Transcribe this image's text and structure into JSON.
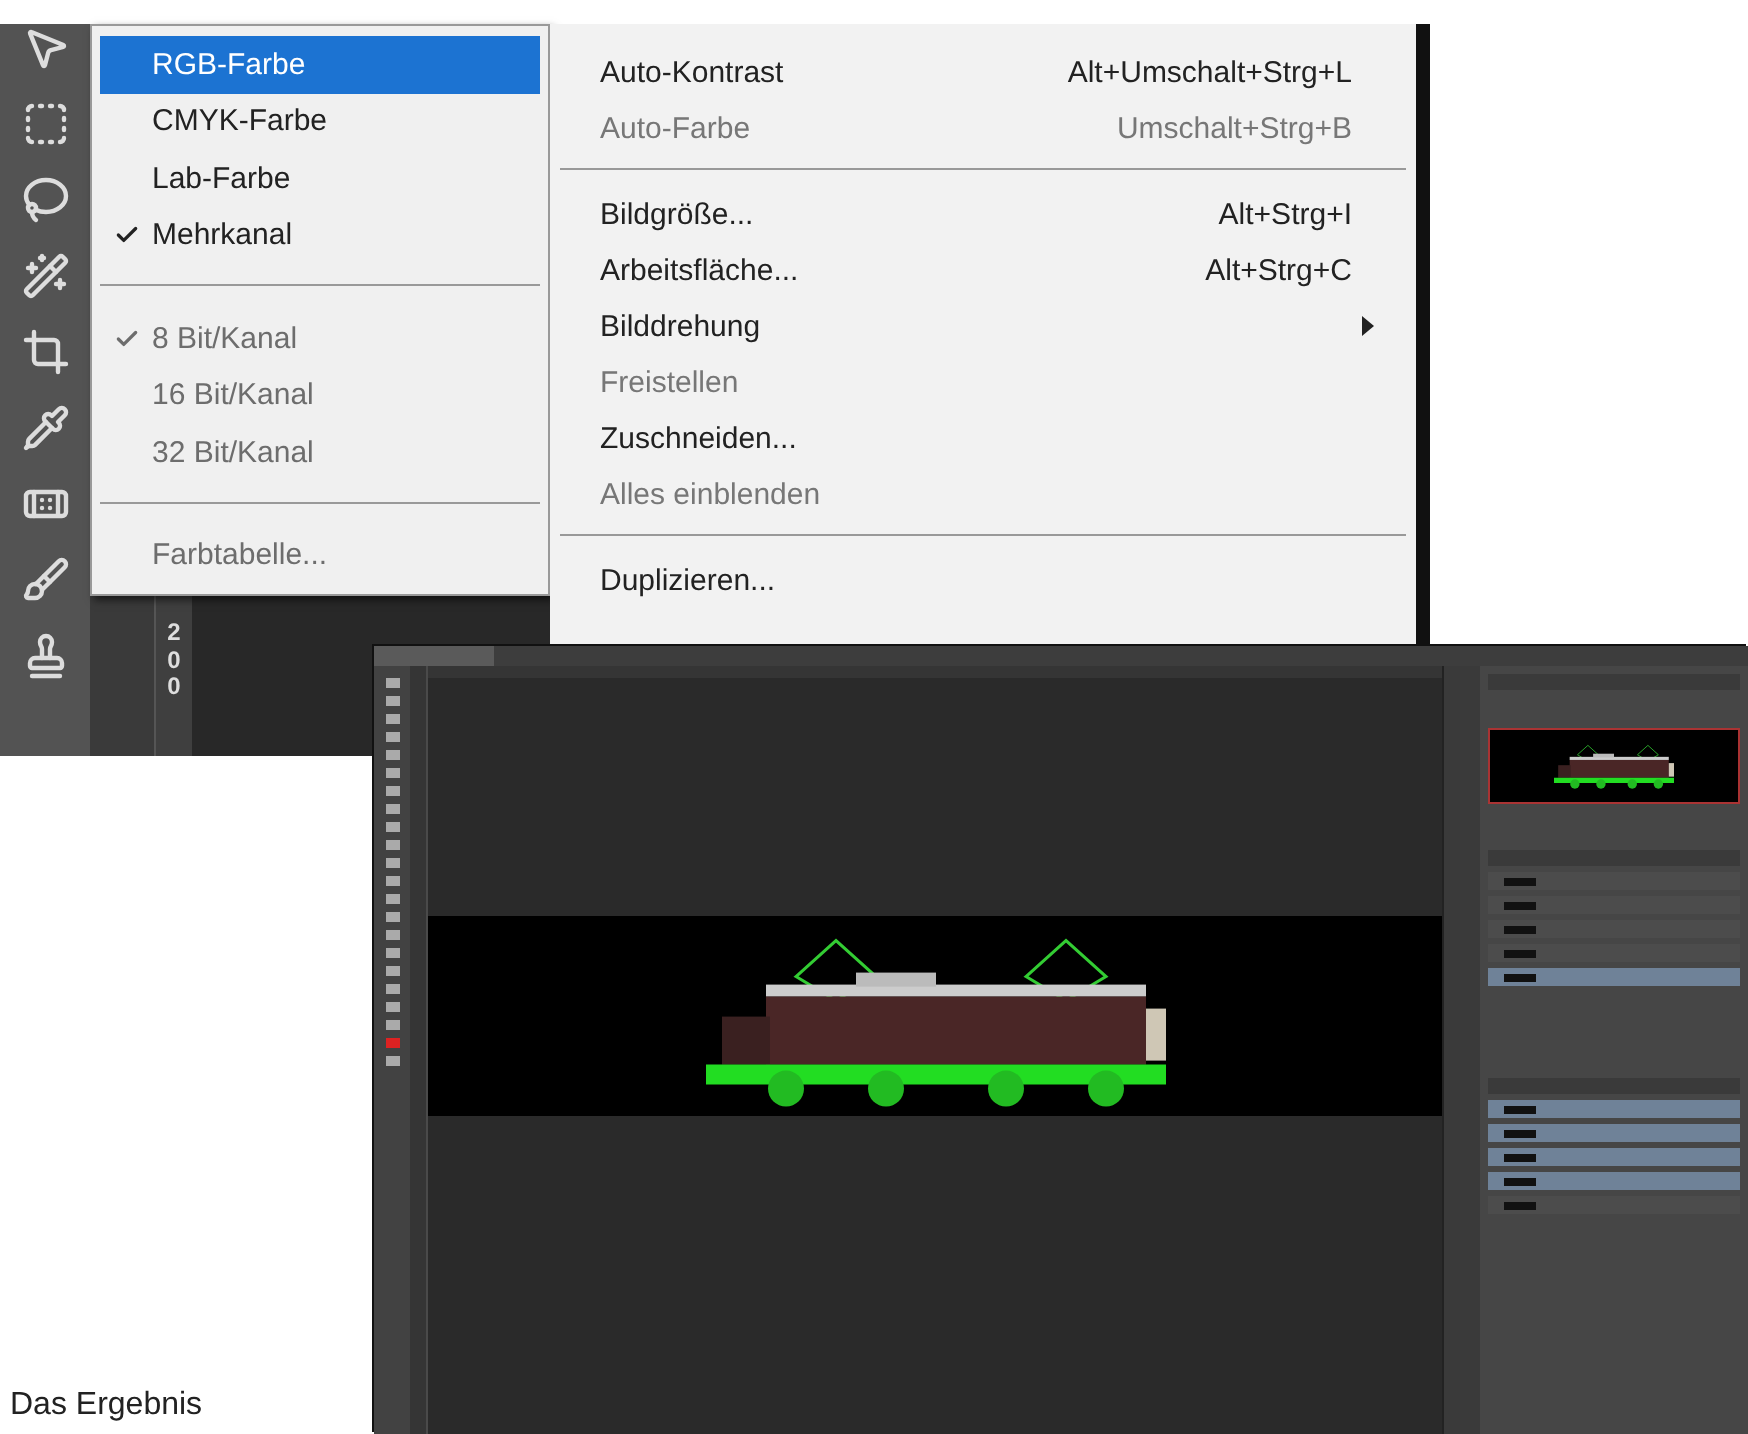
{
  "image_menu": {
    "mode_submenu": {
      "groups": [
        [
          {
            "label": "RGB-Farbe",
            "selected": true,
            "checked": false,
            "disabled": false
          },
          {
            "label": "CMYK-Farbe",
            "selected": false,
            "checked": false,
            "disabled": false
          },
          {
            "label": "Lab-Farbe",
            "selected": false,
            "checked": false,
            "disabled": false
          },
          {
            "label": "Mehrkanal",
            "selected": false,
            "checked": true,
            "disabled": false
          }
        ],
        [
          {
            "label": "8 Bit/Kanal",
            "selected": false,
            "checked": true,
            "disabled": true
          },
          {
            "label": "16 Bit/Kanal",
            "selected": false,
            "checked": false,
            "disabled": true
          },
          {
            "label": "32 Bit/Kanal",
            "selected": false,
            "checked": false,
            "disabled": true
          }
        ],
        [
          {
            "label": "Farbtabelle...",
            "selected": false,
            "checked": false,
            "disabled": true
          }
        ]
      ]
    },
    "menu": {
      "groups": [
        [
          {
            "label": "Auto-Kontrast",
            "shortcut": "Alt+Umschalt+Strg+L",
            "disabled": false,
            "has_submenu": false
          },
          {
            "label": "Auto-Farbe",
            "shortcut": "Umschalt+Strg+B",
            "disabled": true,
            "has_submenu": false
          }
        ],
        [
          {
            "label": "Bildgröße...",
            "shortcut": "Alt+Strg+I",
            "disabled": false,
            "has_submenu": false
          },
          {
            "label": "Arbeitsfläche...",
            "shortcut": "Alt+Strg+C",
            "disabled": false,
            "has_submenu": false
          },
          {
            "label": "Bilddrehung",
            "disabled": false,
            "has_submenu": true
          },
          {
            "label": "Freistellen",
            "disabled": true,
            "has_submenu": false
          },
          {
            "label": "Zuschneiden...",
            "disabled": false,
            "has_submenu": false
          },
          {
            "label": "Alles einblenden",
            "disabled": true,
            "has_submenu": false
          }
        ],
        [
          {
            "label": "Duplizieren...",
            "disabled": false,
            "has_submenu": false
          }
        ]
      ]
    },
    "ruler_label": "200"
  },
  "result": {
    "layers": [
      {
        "selected": false
      },
      {
        "selected": false
      },
      {
        "selected": false
      },
      {
        "selected": false
      },
      {
        "selected": true
      }
    ],
    "channels": [
      {
        "selected": true
      },
      {
        "selected": true
      },
      {
        "selected": true
      },
      {
        "selected": true
      },
      {
        "selected": false
      }
    ],
    "caption": "Das Ergebnis"
  }
}
